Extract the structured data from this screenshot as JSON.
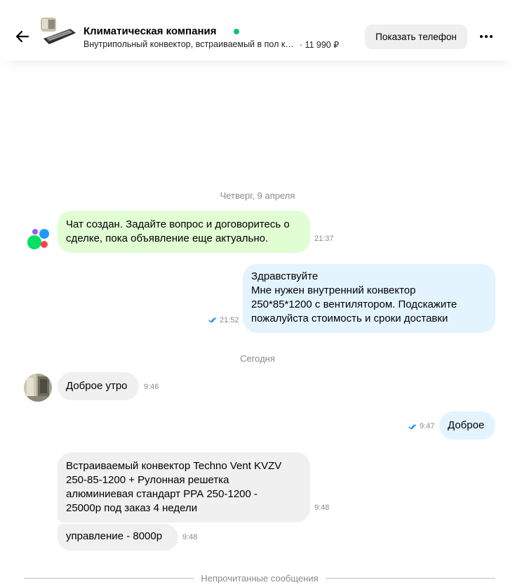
{
  "header": {
    "back_icon": "arrow-left-icon",
    "seller_name": "Климатическая компания",
    "online_color": "#00c66b",
    "ad_title": "Внутрипольный конвектор, встраиваемый в пол к…",
    "ad_price": "· 11 990 ₽",
    "show_phone_label": "Показать телефон",
    "more_icon": "more-horizontal-icon"
  },
  "chat": {
    "date1": "Четверг, 9 апреля",
    "system_message": {
      "lines": [
        "Чат создан. Задайте вопрос и договоритесь о",
        "сделке, пока объявление еще актуально."
      ],
      "time": "21:37"
    },
    "outgoing1": {
      "lines": [
        "Здравствуйте",
        "Мне нужен внутренний конвектор",
        "250*85*1200 с вентилятором. Подскажите",
        "пожалуйста стоимость и сроки доставки"
      ],
      "time": "21:52"
    },
    "date2": "Сегодня",
    "incoming1": {
      "text": "Доброе утро",
      "time": "9:46"
    },
    "outgoing2": {
      "text": "Доброе",
      "time": "9:47"
    },
    "incoming2": {
      "lines": [
        "Встраиваемый конвектор Techno Vent KVZV",
        "250-85-1200 + Рулонная решетка",
        "алюминиевая стандарт РРА 250-1200 -",
        "25000р под заказ 4 недели"
      ],
      "time": "9:48"
    },
    "incoming3": {
      "text": "управление  - 8000р",
      "time": "9:48"
    },
    "unread_label": "Непрочитанные сообщения"
  },
  "colors": {
    "system_bubble": "#e1fdd4",
    "outgoing_bubble": "#e3f4ff",
    "incoming_bubble": "#f0f0f0",
    "read_checks": "#1a8fe6"
  }
}
